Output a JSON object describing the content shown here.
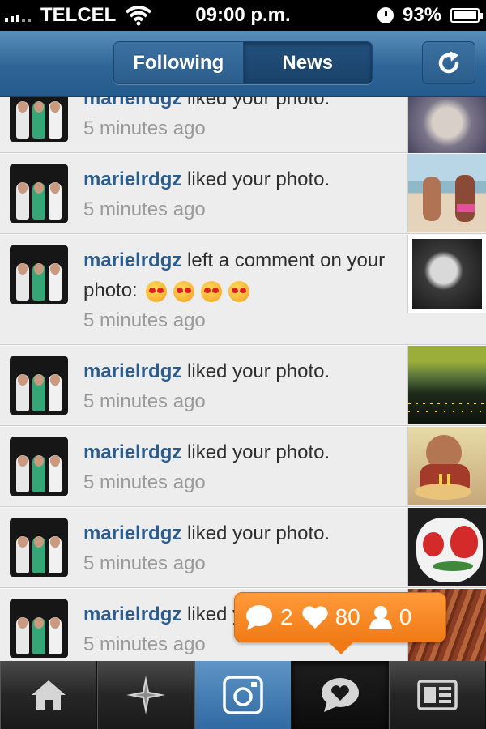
{
  "status_bar": {
    "carrier": "TELCEL",
    "time": "09:00 p.m.",
    "battery": "93%"
  },
  "nav": {
    "tabs": [
      {
        "label": "Following",
        "selected": false
      },
      {
        "label": "News",
        "selected": true
      }
    ],
    "refresh_icon": "refresh-icon"
  },
  "feed": {
    "items": [
      {
        "user": "marielrdgz",
        "action": " liked your photo.",
        "time": "5 minutes ago",
        "thumb_icon": "coral-photo"
      },
      {
        "user": "marielrdgz",
        "action": " liked your photo.",
        "time": "5 minutes ago",
        "thumb_icon": "beach-photo"
      },
      {
        "user": "marielrdgz",
        "action": " left a comment on your photo:",
        "time": "5 minutes ago",
        "emoji": "heart-eyes-emoji x4",
        "thumb_icon": "child-photo"
      },
      {
        "user": "marielrdgz",
        "action": " liked your photo.",
        "time": "5 minutes ago",
        "thumb_icon": "city-sunset-photo"
      },
      {
        "user": "marielrdgz",
        "action": " liked your photo.",
        "time": "5 minutes ago",
        "thumb_icon": "birthday-photo"
      },
      {
        "user": "marielrdgz",
        "action": " liked your photo.",
        "time": "5 minutes ago",
        "thumb_icon": "mug-photo"
      },
      {
        "user": "marielrdgz",
        "action": " liked your photo.",
        "time": "5 minutes ago",
        "thumb_icon": "hair-photo"
      }
    ]
  },
  "activity": {
    "comments": "2",
    "likes": "80",
    "followers": "0",
    "color": "#f28a25"
  },
  "tab_bar": {
    "items": [
      "home-icon",
      "explore-icon",
      "camera-icon",
      "news-icon",
      "profile-icon"
    ],
    "active": "news-icon"
  },
  "colors": {
    "nav_blue": "#2e6597",
    "username": "#2b5c8e",
    "time_gray": "#9a9a9a"
  }
}
